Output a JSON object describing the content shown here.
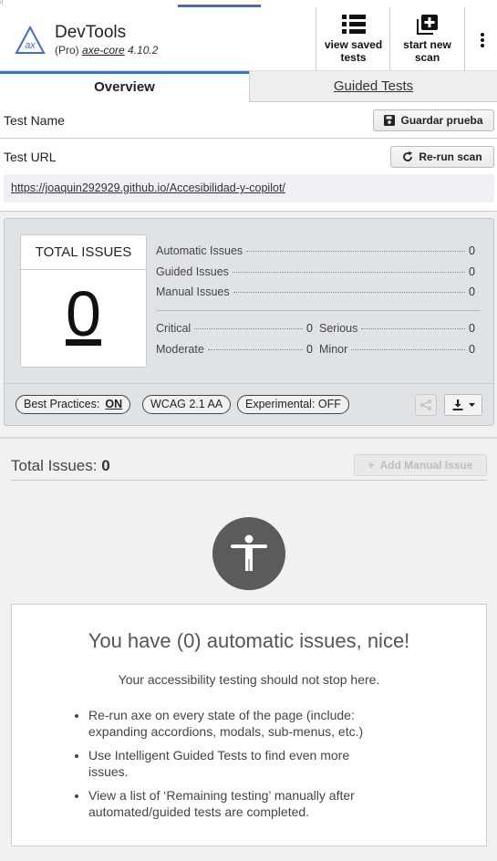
{
  "header": {
    "corner_fragment": "ı|",
    "title": "DevTools",
    "plan": "(Pro)",
    "engine": "axe-core",
    "version": "4.10.2",
    "logo_text": "ax",
    "view_saved_label_1": "view saved",
    "view_saved_label_2": "tests",
    "start_new_label_1": "start new",
    "start_new_label_2": "scan"
  },
  "tabs": {
    "overview": "Overview",
    "guided": "Guided Tests"
  },
  "test_info": {
    "name_label": "Test Name",
    "save_button": "Guardar prueba",
    "url_label": "Test URL",
    "rerun_button": "Re-run scan",
    "url": "https://joaquin292929.github.io/Accesibilidad-y-copilot/"
  },
  "summary": {
    "total_label": "TOTAL ISSUES",
    "total_value": "0",
    "automatic_label": "Automatic Issues",
    "automatic_value": "0",
    "guided_label": "Guided Issues",
    "guided_value": "0",
    "manual_label": "Manual Issues",
    "manual_value": "0",
    "critical_label": "Critical",
    "critical_value": "0",
    "serious_label": "Serious",
    "serious_value": "0",
    "moderate_label": "Moderate",
    "moderate_value": "0",
    "minor_label": "Minor",
    "minor_value": "0",
    "best_practices_label": "Best Practices:",
    "best_practices_value": "ON",
    "wcag_label": "WCAG 2.1 AA",
    "experimental_label": "Experimental: OFF"
  },
  "issues": {
    "total_label": "Total Issues:",
    "total_value": "0",
    "add_manual_label": "Add Manual Issue"
  },
  "message": {
    "title": "You have (0) automatic issues, nice!",
    "subtitle": "Your accessibility testing should not stop here.",
    "items": [
      "Re-run axe on every state of the page (include: expanding accordions, modals, sub-menus, etc.)",
      "Use Intelligent Guided Tests to find even more issues.",
      "View a list of ‘Remaining testing’ manually after automated/guided tests are completed."
    ]
  },
  "colors": {
    "accent": "#3f6ec6",
    "summary_bg": "#dfe3e6",
    "icon_circle": "#5b5b5b"
  }
}
